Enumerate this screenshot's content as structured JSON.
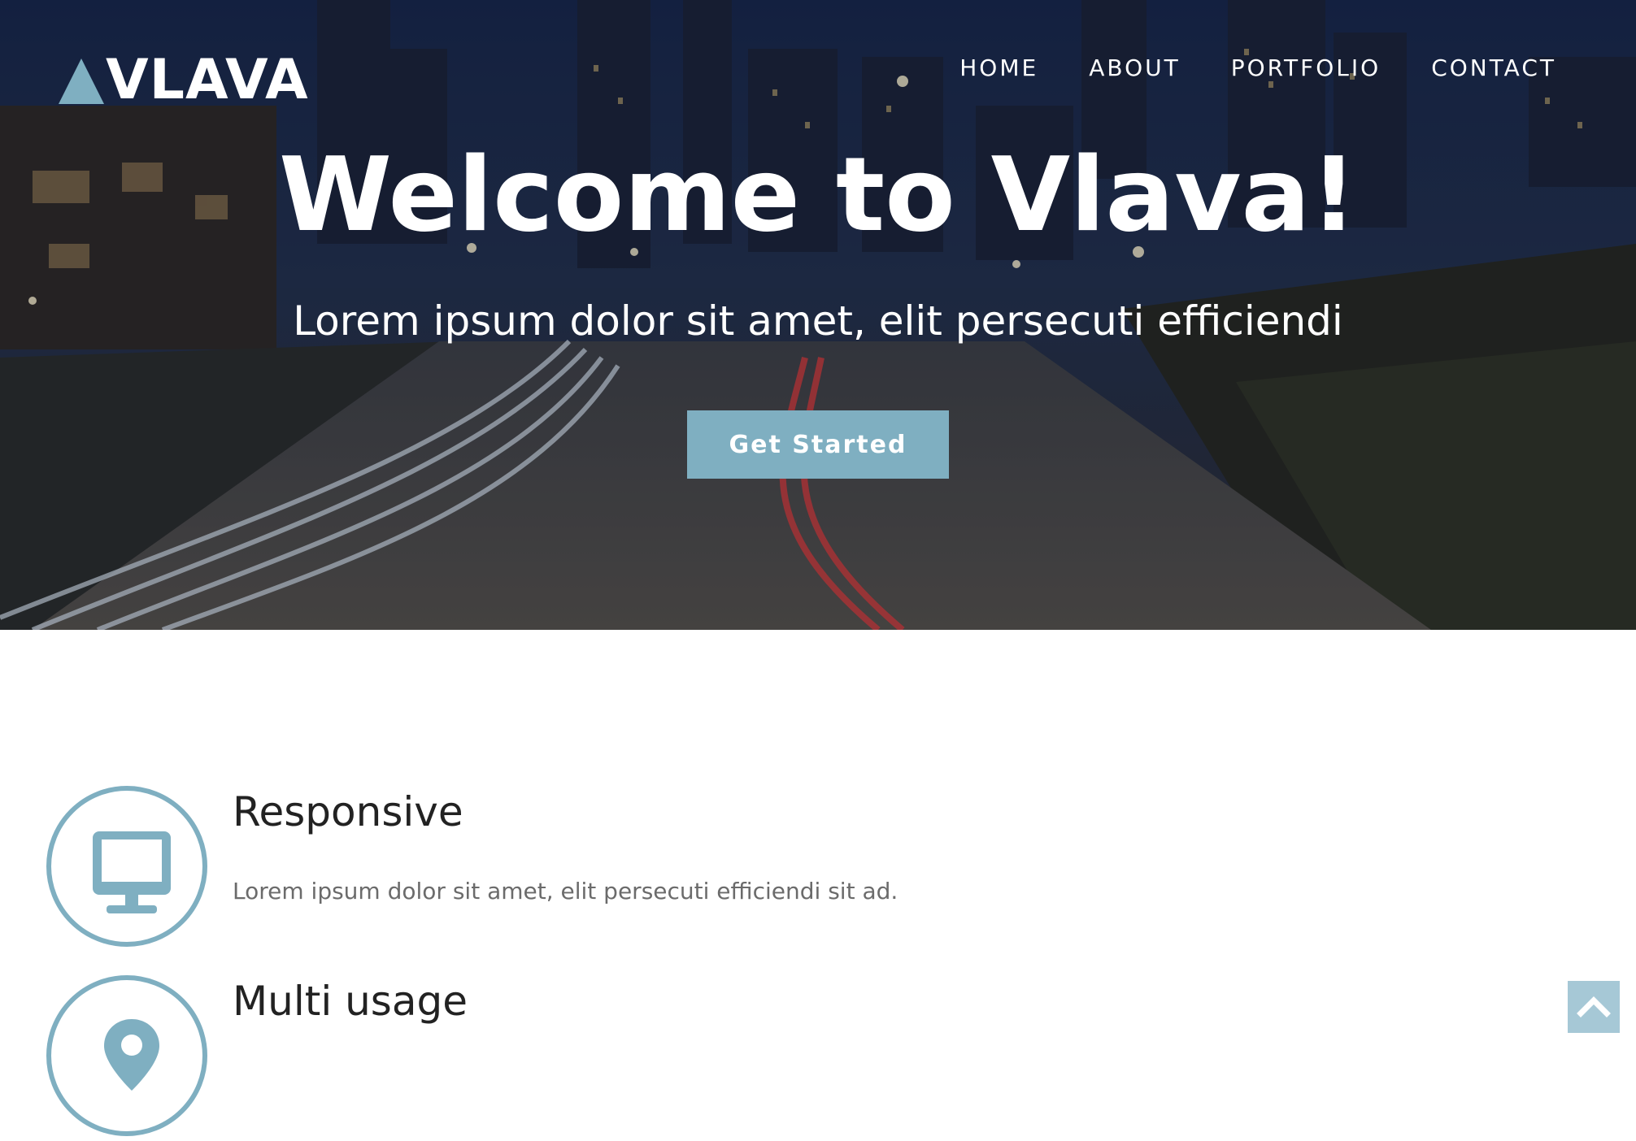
{
  "brand": {
    "logo_text": "VLAVA"
  },
  "nav": {
    "items": [
      "HOME",
      "ABOUT",
      "PORTFOLIO",
      "CONTACT"
    ]
  },
  "hero": {
    "title": "Welcome to Vlava!",
    "subtitle": "Lorem ipsum dolor sit amet, elit persecuti efficiendi",
    "cta_label": "Get Started"
  },
  "features": [
    {
      "icon": "monitor-icon",
      "title": "Responsive",
      "text": "Lorem ipsum dolor sit amet, elit persecuti efficiendi sit ad."
    },
    {
      "icon": "location-pin-icon",
      "title": "Multi usage"
    }
  ],
  "back_to_top": {
    "icon": "chevron-up-icon"
  },
  "colors": {
    "accent": "#7fafc1",
    "back_to_top": "#a6c8d6",
    "heading": "#222222",
    "body_text": "#6b6b6b"
  }
}
